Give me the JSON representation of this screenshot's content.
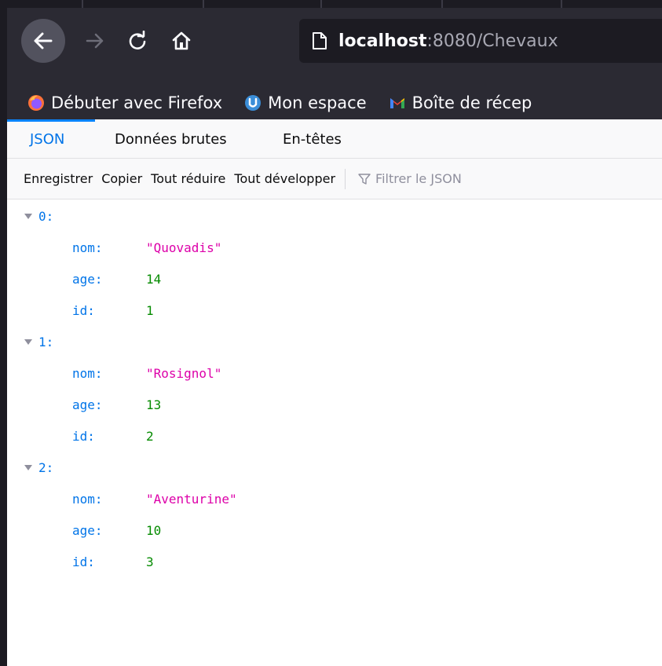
{
  "browser": {
    "url_host": "localhost",
    "url_rest": ":8080/Chevaux",
    "bookmarks": [
      {
        "label": "Débuter avec Firefox",
        "icon": "firefox-icon"
      },
      {
        "label": "Mon espace",
        "icon": "globe-icon"
      },
      {
        "label": "Boîte de récep",
        "icon": "gmail-icon"
      }
    ]
  },
  "viewer": {
    "tabs": [
      "JSON",
      "Données brutes",
      "En-têtes"
    ],
    "toolbar": {
      "save": "Enregistrer",
      "copy": "Copier",
      "collapse": "Tout réduire",
      "expand": "Tout développer",
      "filter_placeholder": "Filtrer le JSON"
    }
  },
  "json": [
    {
      "index": "0:",
      "fields": [
        {
          "key": "nom:",
          "value": "\"Quovadis\"",
          "type": "string"
        },
        {
          "key": "age:",
          "value": "14",
          "type": "number"
        },
        {
          "key": "id:",
          "value": "1",
          "type": "number"
        }
      ]
    },
    {
      "index": "1:",
      "fields": [
        {
          "key": "nom:",
          "value": "\"Rosignol\"",
          "type": "string"
        },
        {
          "key": "age:",
          "value": "13",
          "type": "number"
        },
        {
          "key": "id:",
          "value": "2",
          "type": "number"
        }
      ]
    },
    {
      "index": "2:",
      "fields": [
        {
          "key": "nom:",
          "value": "\"Aventurine\"",
          "type": "string"
        },
        {
          "key": "age:",
          "value": "10",
          "type": "number"
        },
        {
          "key": "id:",
          "value": "3",
          "type": "number"
        }
      ]
    }
  ],
  "colors": {
    "key": "#0074e8",
    "string": "#dd00a9",
    "number": "#058b00",
    "accent": "#0a84ff"
  }
}
